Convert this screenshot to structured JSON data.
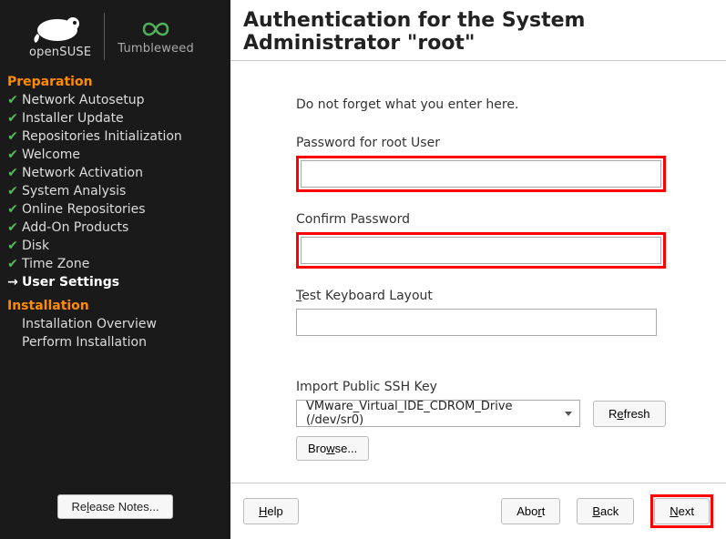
{
  "branding": {
    "product": "openSUSE",
    "variant": "Tumbleweed"
  },
  "sidebar": {
    "section1": "Preparation",
    "items1": [
      "Network Autosetup",
      "Installer Update",
      "Repositories Initialization",
      "Welcome",
      "Network Activation",
      "System Analysis",
      "Online Repositories",
      "Add-On Products",
      "Disk",
      "Time Zone",
      "User Settings"
    ],
    "section2": "Installation",
    "items2": [
      "Installation Overview",
      "Perform Installation"
    ],
    "release_notes": "Release Notes..."
  },
  "page": {
    "title": "Authentication for the System Administrator \"root\"",
    "hint": "Do not forget what you enter here.",
    "password_label": "Password for root User",
    "password_value": "",
    "confirm_label": "Confirm Password",
    "confirm_value": "",
    "test_kb_label_pre": "T",
    "test_kb_label_rest": "est Keyboard Layout",
    "test_kb_value": "",
    "import_label": "Import Public SSH Key",
    "ssh_device_selected": "VMware_Virtual_IDE_CDROM_Drive (/dev/sr0)",
    "refresh_pre": "R",
    "refresh_mn": "e",
    "refresh_post": "fresh",
    "browse_pre": "Bro",
    "browse_mn": "w",
    "browse_post": "se..."
  },
  "footer": {
    "help_mn": "H",
    "help_post": "elp",
    "abort_pre": "Abo",
    "abort_mn": "r",
    "abort_post": "t",
    "back_mn": "B",
    "back_post": "ack",
    "next_mn": "N",
    "next_post": "ext"
  }
}
